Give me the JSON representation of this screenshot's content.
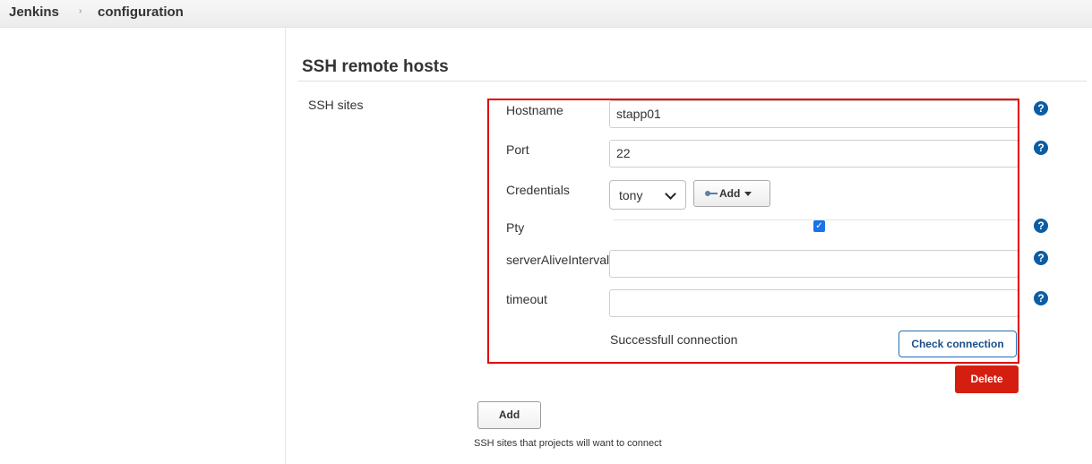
{
  "breadcrumb": {
    "items": [
      "Jenkins",
      "configuration"
    ],
    "separator": "›"
  },
  "section": {
    "title": "SSH remote hosts",
    "sites_label": "SSH sites",
    "description": "SSH sites that projects will want to connect"
  },
  "site": {
    "hostname": {
      "label": "Hostname",
      "value": "stapp01"
    },
    "port": {
      "label": "Port",
      "value": "22"
    },
    "credentials": {
      "label": "Credentials",
      "selected": "tony",
      "add_label": "Add"
    },
    "pty": {
      "label": "Pty",
      "checked": true
    },
    "server_alive_interval": {
      "label": "serverAliveInterval",
      "value": ""
    },
    "timeout": {
      "label": "timeout",
      "value": ""
    },
    "status": "Successfull connection",
    "check_label": "Check connection",
    "delete_label": "Delete"
  },
  "add_label": "Add",
  "help_glyph": "?",
  "icons": {
    "help": "help-icon",
    "key": "key-icon",
    "dropdown": "caret-down-icon",
    "check": "checkmark-icon"
  },
  "colors": {
    "help": "#0b5da4",
    "delete": "#d41f10",
    "highlight": "#e00000",
    "checkbox": "#1a73e8"
  }
}
